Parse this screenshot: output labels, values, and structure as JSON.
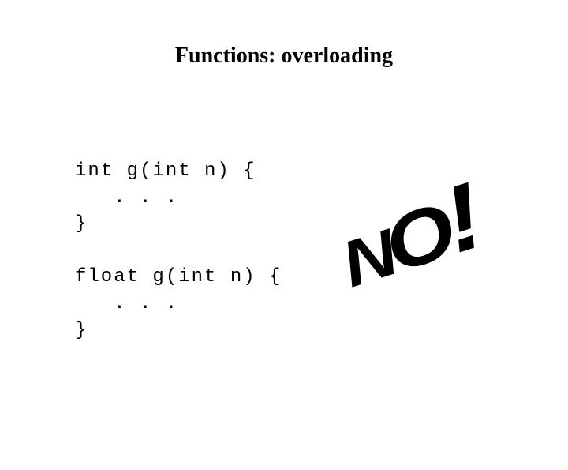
{
  "title": "Functions:  overloading",
  "code": "int g(int n) {\n   . . .\n}\n\nfloat g(int n) {\n   . . .\n}",
  "stamp": {
    "n": "N",
    "o": "O",
    "bang": "!"
  }
}
